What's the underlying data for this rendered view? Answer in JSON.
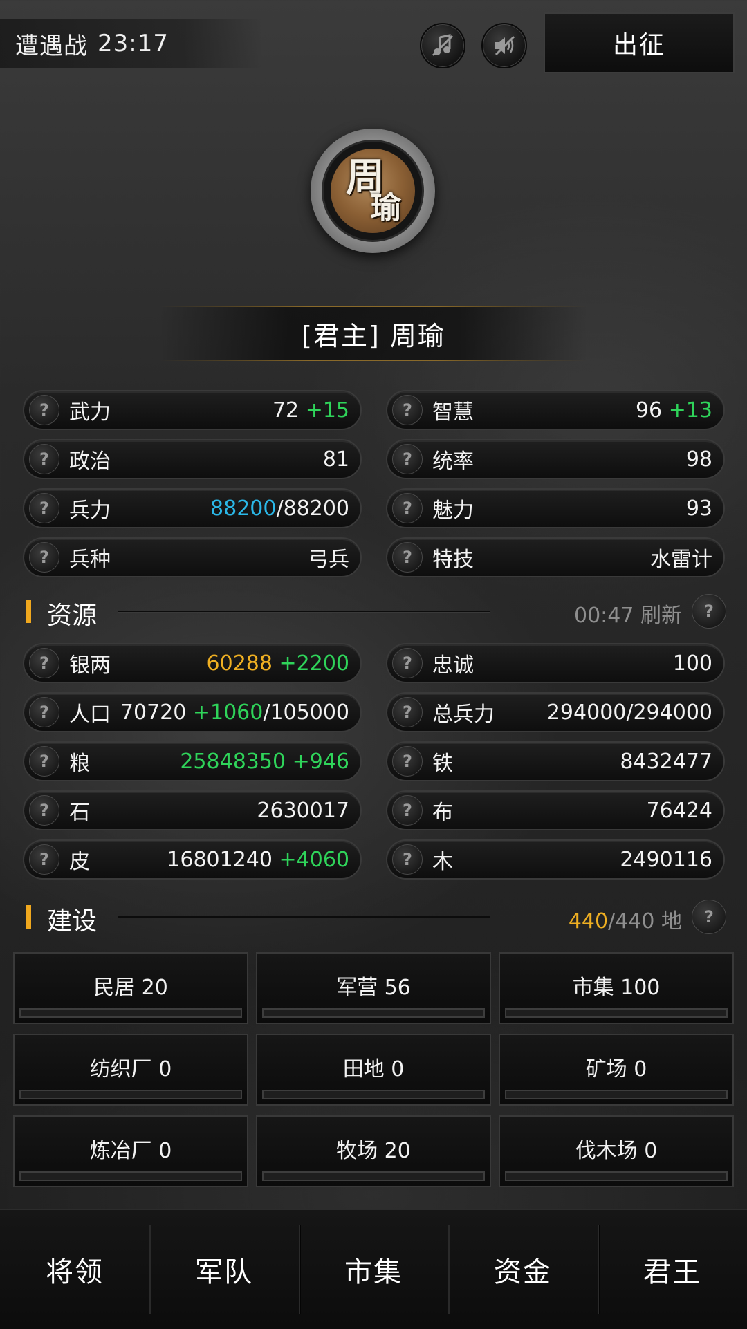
{
  "topbar": {
    "battle_label": "遭遇战",
    "battle_time": "23:17",
    "music_icon": "music-off-icon",
    "sound_icon": "sound-off-icon",
    "march_label": "出征"
  },
  "avatar": {
    "char1": "周",
    "char2": "瑜"
  },
  "header": {
    "name": "[君主] 周瑜"
  },
  "stats": [
    {
      "label": "武力",
      "value": "72",
      "bonus": "+15"
    },
    {
      "label": "智慧",
      "value": "96",
      "bonus": "+13"
    },
    {
      "label": "政治",
      "value": "81",
      "bonus": ""
    },
    {
      "label": "统率",
      "value": "98",
      "bonus": ""
    },
    {
      "label": "兵力",
      "current": "88200",
      "max": "/88200"
    },
    {
      "label": "魅力",
      "value": "93",
      "bonus": ""
    },
    {
      "label": "兵种",
      "value": "弓兵",
      "bonus": ""
    },
    {
      "label": "特技",
      "value": "水雷计",
      "bonus": ""
    }
  ],
  "resources_section": {
    "title": "资源",
    "refresh_text": "00:47 刷新"
  },
  "resources": {
    "silver": {
      "label": "银两",
      "value": "60288",
      "gain": "+2200"
    },
    "loyalty": {
      "label": "忠诚",
      "value": "100"
    },
    "population": {
      "label": "人口",
      "value": "70720",
      "gain": "+1060",
      "max": "/105000"
    },
    "total_troops": {
      "label": "总兵力",
      "value": "294000/294000"
    },
    "grain": {
      "label": "粮",
      "value": "25848350",
      "gain": "+946"
    },
    "iron": {
      "label": "铁",
      "value": "8432477"
    },
    "stone": {
      "label": "石",
      "value": "2630017"
    },
    "cloth": {
      "label": "布",
      "value": "76424"
    },
    "leather": {
      "label": "皮",
      "value": "16801240",
      "gain": "+4060"
    },
    "wood": {
      "label": "木",
      "value": "2490116"
    }
  },
  "construction_section": {
    "title": "建设",
    "used": "440",
    "total": "/440 地"
  },
  "buildings": [
    {
      "label": "民居 20",
      "progress": 0
    },
    {
      "label": "军营 56",
      "progress": 0
    },
    {
      "label": "市集 100",
      "progress": 0
    },
    {
      "label": "纺织厂 0",
      "progress": 0
    },
    {
      "label": "田地 0",
      "progress": 0
    },
    {
      "label": "矿场 0",
      "progress": 0
    },
    {
      "label": "炼冶厂 0",
      "progress": 0
    },
    {
      "label": "牧场 20",
      "progress": 0
    },
    {
      "label": "伐木场 0",
      "progress": 0
    }
  ],
  "nav": [
    "将领",
    "军队",
    "市集",
    "资金",
    "君王"
  ],
  "colors": {
    "accent": "#f0a81e",
    "positive": "#2fd45a",
    "troops": "#2bb8e8",
    "silver": "#f0b022"
  }
}
